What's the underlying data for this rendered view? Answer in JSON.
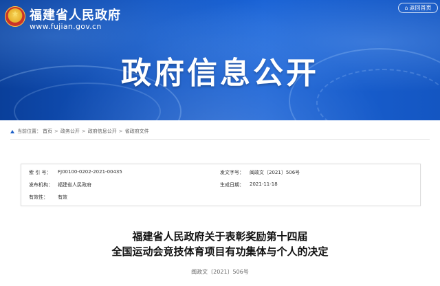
{
  "header": {
    "site_name": "福建省人民政府",
    "site_url": "www.fujian.gov.cn",
    "return_home": "返回首页",
    "banner_title": "政府信息公开",
    "colors": {
      "banner_blue": "#1457c4",
      "emblem_red": "#d43a2c",
      "emblem_gold": "#e7b22c"
    }
  },
  "breadcrumb": {
    "prefix": "当前位置：",
    "items": [
      "首页",
      "政务公开",
      "政府信息公开",
      "省政府文件"
    ],
    "separator": ">"
  },
  "meta": {
    "index_label": "索 引 号：",
    "index_value": "FJ00100-0202-2021-00435",
    "doc_no_label": "发文字号：",
    "doc_no_value": "闽政文〔2021〕506号",
    "issuer_label": "发布机构：",
    "issuer_value": "福建省人民政府",
    "date_label": "生成日期：",
    "date_value": "2021-11-18",
    "validity_label": "有效性：",
    "validity_value": "有效"
  },
  "document": {
    "title_line1": "福建省人民政府关于表彰奖励第十四届",
    "title_line2": "全国运动会竞技体育项目有功集体与个人的决定",
    "number": "闽政文〔2021〕506号"
  }
}
